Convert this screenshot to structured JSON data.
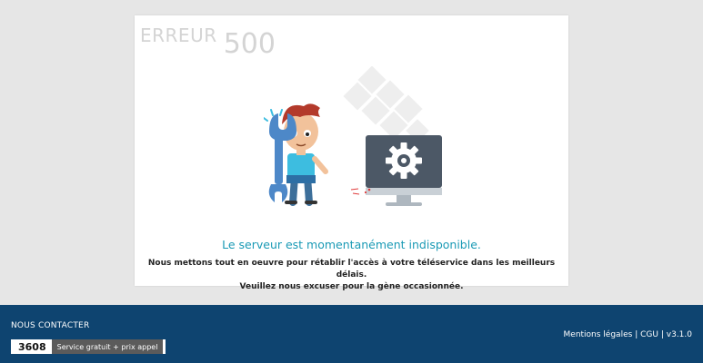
{
  "error": {
    "word": "ERREUR",
    "code": "500"
  },
  "message": {
    "headline": "Le serveur est momentanément indisponible.",
    "line1": "Nous mettons tout en oeuvre pour rétablir l'accès à votre téléservice dans les meilleurs délais.",
    "line2": "Veuillez nous excuser pour la gène occasionnée."
  },
  "footer": {
    "contact_label": "NOUS CONTACTER",
    "phone_number": "3608",
    "phone_service": "Service gratuit + prix appel",
    "links": [
      {
        "label": "Mentions légales"
      },
      {
        "label": "CGU"
      }
    ],
    "separator": "|",
    "version": "v3.1.0"
  },
  "colors": {
    "page_bg": "#e6e6e6",
    "card_bg": "#ffffff",
    "accent": "#1a9ab5",
    "footer_bg": "#0e4470",
    "error_text": "#d4d4d4"
  }
}
